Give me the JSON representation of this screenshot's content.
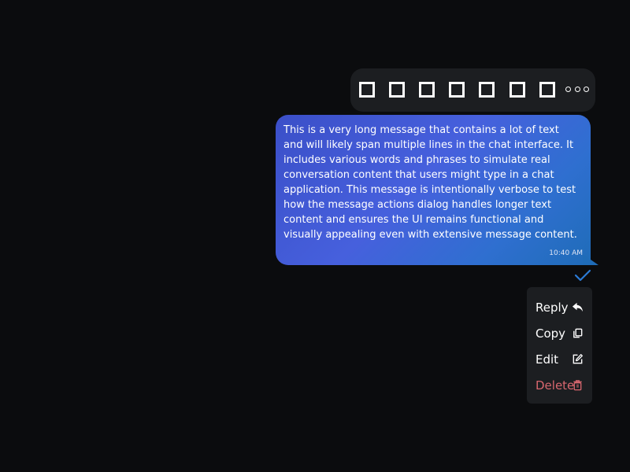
{
  "reactions": {
    "items": [
      {
        "icon": "missing-glyph-icon"
      },
      {
        "icon": "missing-glyph-icon"
      },
      {
        "icon": "missing-glyph-icon"
      },
      {
        "icon": "missing-glyph-icon"
      },
      {
        "icon": "missing-glyph-icon"
      },
      {
        "icon": "missing-glyph-icon"
      },
      {
        "icon": "missing-glyph-icon"
      }
    ],
    "more_icon": "more-horizontal-icon"
  },
  "message": {
    "text": "This is a very long message that contains a lot of text and will likely span multiple lines in the chat interface. It includes various words and phrases to simulate real conversation content that users might type in a chat application. This message is intentionally verbose to test how the message actions dialog handles longer text content and ensures the UI remains functional and visually appealing even with extensive message content.",
    "time": "10:40 AM",
    "status_icon": "checkmark-icon"
  },
  "actions": {
    "reply_label": "Reply",
    "copy_label": "Copy",
    "edit_label": "Edit",
    "delete_label": "Delete"
  },
  "colors": {
    "background": "#0b0c0e",
    "panel": "#1c1e21",
    "bubble_start": "#3b4fc8",
    "bubble_end": "#1f6cb8",
    "check": "#2b7bd6",
    "danger": "#d9676f"
  }
}
